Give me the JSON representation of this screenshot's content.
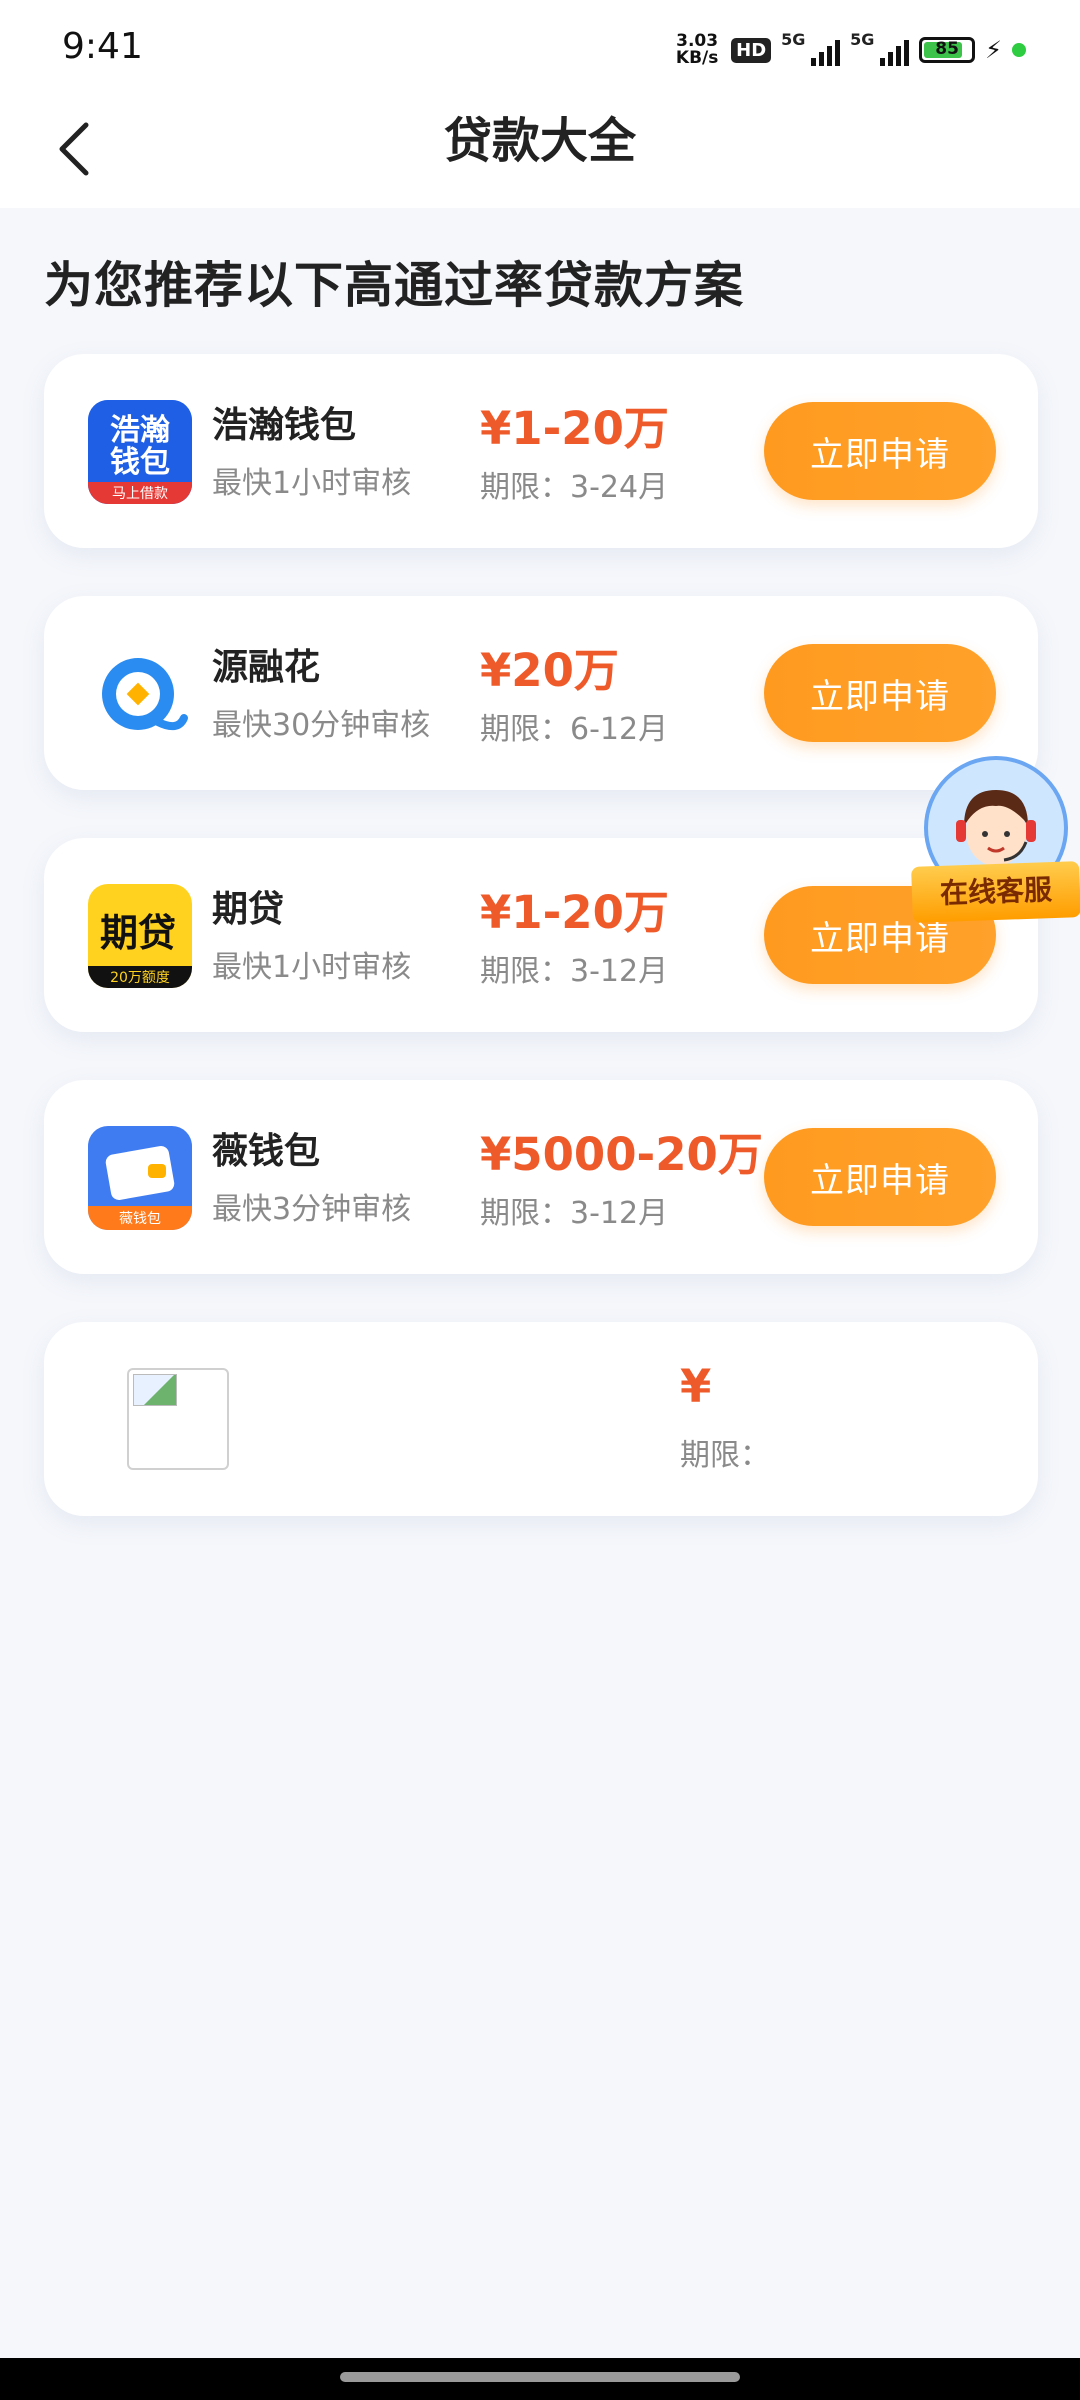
{
  "status_bar": {
    "time": "9:41",
    "net_speed": "3.03 KB/s",
    "hd_label": "HD",
    "signal1": "5G",
    "signal2": "5G",
    "battery": "85"
  },
  "nav": {
    "title": "贷款大全",
    "back_icon": "chevron-left-icon"
  },
  "headline": "为您推荐以下高通过率贷款方案",
  "loans": [
    {
      "name": "浩瀚钱包",
      "desc": "最快1小时审核",
      "amount": "¥1-20万",
      "term": "期限：3-24月",
      "button": "立即申请",
      "logo_text": "浩瀚钱包",
      "logo_tag": "马上借款"
    },
    {
      "name": "源融花",
      "desc": "最快30分钟审核",
      "amount": "¥20万",
      "term": "期限：6-12月",
      "button": "立即申请"
    },
    {
      "name": "期贷",
      "desc": "最快1小时审核",
      "amount": "¥1-20万",
      "term": "期限：3-12月",
      "button": "立即申请",
      "logo_text": "期贷",
      "logo_tag": "20万额度"
    },
    {
      "name": "薇钱包",
      "desc": "最快3分钟审核",
      "amount": "¥5000-20万",
      "term": "期限：3-12月",
      "button": "立即申请",
      "logo_tag": "薇钱包"
    }
  ],
  "empty_card": {
    "amount": "¥",
    "term": "期限："
  },
  "customer_service": {
    "label": "在线客服"
  },
  "colors": {
    "accent": "#ef5a2a",
    "button": "#ff9a1f",
    "background": "#f5f7fb"
  }
}
